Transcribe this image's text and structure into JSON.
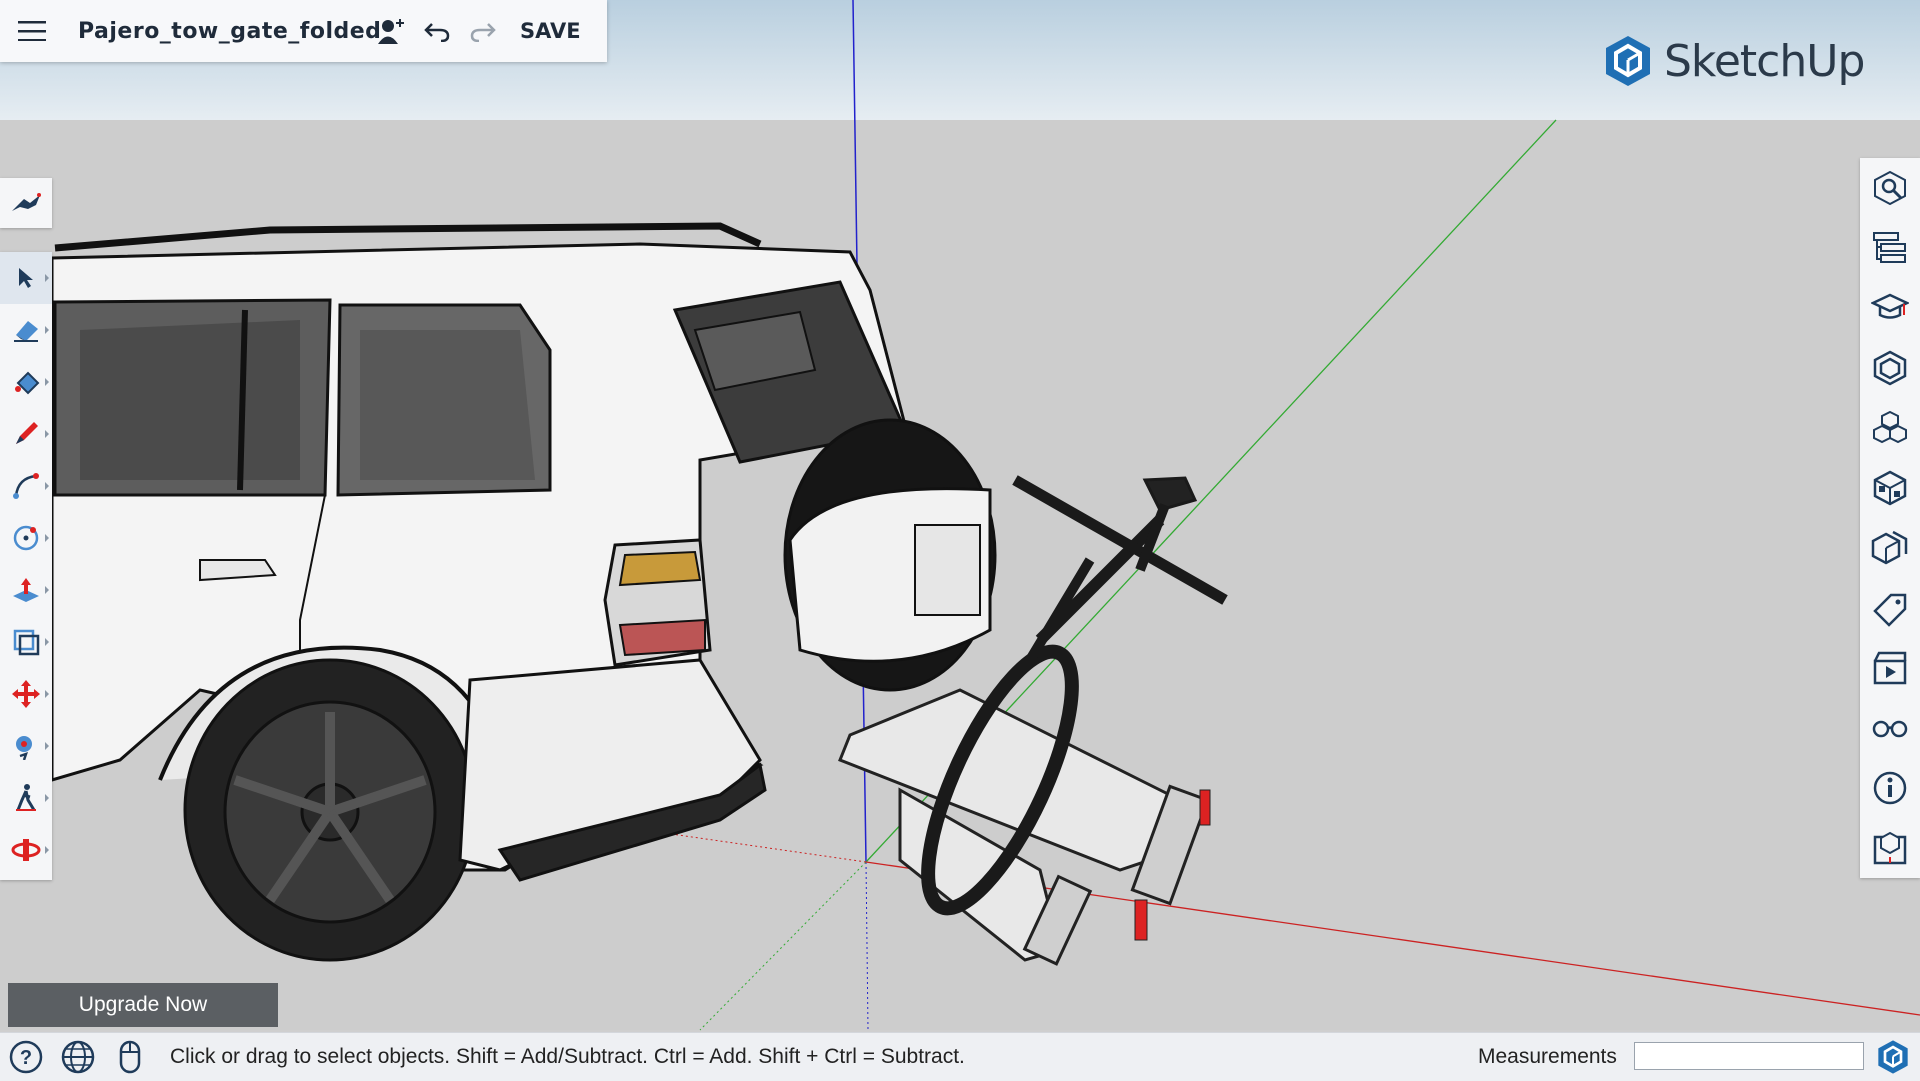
{
  "app": {
    "file_name": "Pajero_tow_gate_folded",
    "save_label": "SAVE",
    "logo_text": "SketchUp"
  },
  "colors": {
    "brand": "#1f6fb4",
    "axis_red": "#cc2222",
    "axis_green": "#33aa33",
    "axis_blue": "#2222cc",
    "status_bar": "#eef0f3"
  },
  "top_toolbar": {
    "icons": [
      "hamburger-menu-icon",
      "add-collaborator-icon",
      "undo-icon",
      "redo-icon"
    ]
  },
  "left_toolbar": {
    "top_tool": "search-tools-icon",
    "tools": [
      "select",
      "eraser",
      "paint-bucket",
      "pencil-line",
      "arc",
      "circle",
      "push-pull",
      "offset",
      "move",
      "orbit",
      "walk",
      "section-plane"
    ]
  },
  "right_panel": {
    "items": [
      "search",
      "outliner",
      "instructor",
      "components",
      "3d-warehouse",
      "materials",
      "styles",
      "tags",
      "scenes",
      "display",
      "entity-info",
      "solid-tools"
    ]
  },
  "upgrade": {
    "label": "Upgrade Now"
  },
  "status_bar": {
    "hint": "Click or drag to select objects. Shift = Add/Subtract. Ctrl = Add. Shift + Ctrl = Subtract.",
    "measurements_label": "Measurements",
    "measurements_value": ""
  }
}
